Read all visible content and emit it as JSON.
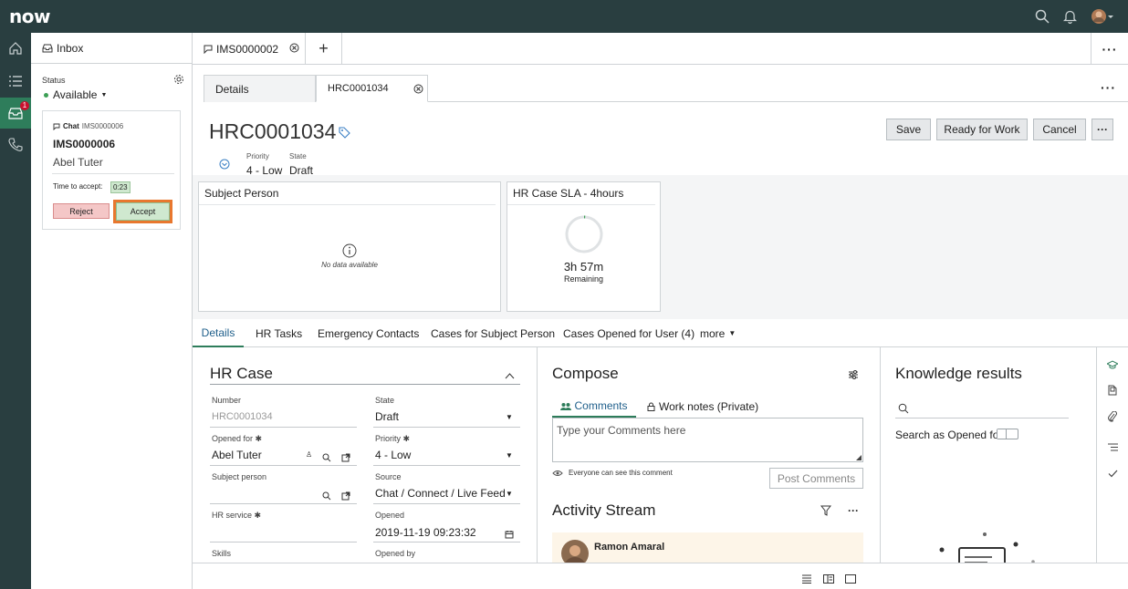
{
  "app": {
    "logo": "now"
  },
  "inbox": {
    "title": "Inbox",
    "status_label": "Status",
    "status_value": "Available",
    "rail_badge": "1",
    "card": {
      "channel": "Chat",
      "id_small": "IMS0000006",
      "id": "IMS0000006",
      "user": "Abel Tuter",
      "time_label": "Time to accept:",
      "time_value": "0:23",
      "reject": "Reject",
      "accept": "Accept"
    }
  },
  "tabs": {
    "main_tab": "IMS0000002",
    "add": "+"
  },
  "subtabs": {
    "details": "Details",
    "record": "HRC0001034"
  },
  "record": {
    "number": "HRC0001034",
    "priority_label": "Priority",
    "priority_value": "4 - Low",
    "state_label": "State",
    "state_value": "Draft",
    "actions": {
      "save": "Save",
      "ready": "Ready for Work",
      "cancel": "Cancel"
    }
  },
  "widgets": {
    "subject_person": {
      "title": "Subject Person",
      "empty": "No data available"
    },
    "sla": {
      "title": "HR Case SLA - 4hours",
      "time": "3h 57m",
      "remaining": "Remaining",
      "progress": 0.01
    }
  },
  "content_tabs": [
    "Details",
    "HR Tasks",
    "Emergency Contacts",
    "Cases for Subject Person",
    "Cases Opened for User (4)",
    "more"
  ],
  "hr_case": {
    "title": "HR Case",
    "number_label": "Number",
    "number_value": "HRC0001034",
    "state_label": "State",
    "state_value": "Draft",
    "opened_for_label": "Opened for",
    "opened_for_value": "Abel Tuter",
    "priority_label": "Priority",
    "priority_value": "4 - Low",
    "subject_person_label": "Subject person",
    "source_label": "Source",
    "source_value": "Chat / Connect / Live Feed",
    "hr_service_label": "HR service",
    "opened_label": "Opened",
    "opened_value": "2019-11-19 09:23:32",
    "skills_label": "Skills",
    "opened_by_label": "Opened by"
  },
  "compose": {
    "title": "Compose",
    "tab_comments": "Comments",
    "tab_worknotes": "Work notes (Private)",
    "placeholder": "Type your Comments here",
    "visibility": "Everyone can see this comment",
    "post": "Post Comments",
    "activity_title": "Activity Stream",
    "activity_user": "Ramon Amaral"
  },
  "knowledge": {
    "title": "Knowledge results",
    "search_as": "Search as Opened for"
  },
  "colors": {
    "topbar": "#293e40",
    "accent": "#2e7d5b",
    "accept_border": "#e8772e",
    "reject_bg": "#f4c7c7",
    "accept_bg": "#cfe8cf"
  }
}
